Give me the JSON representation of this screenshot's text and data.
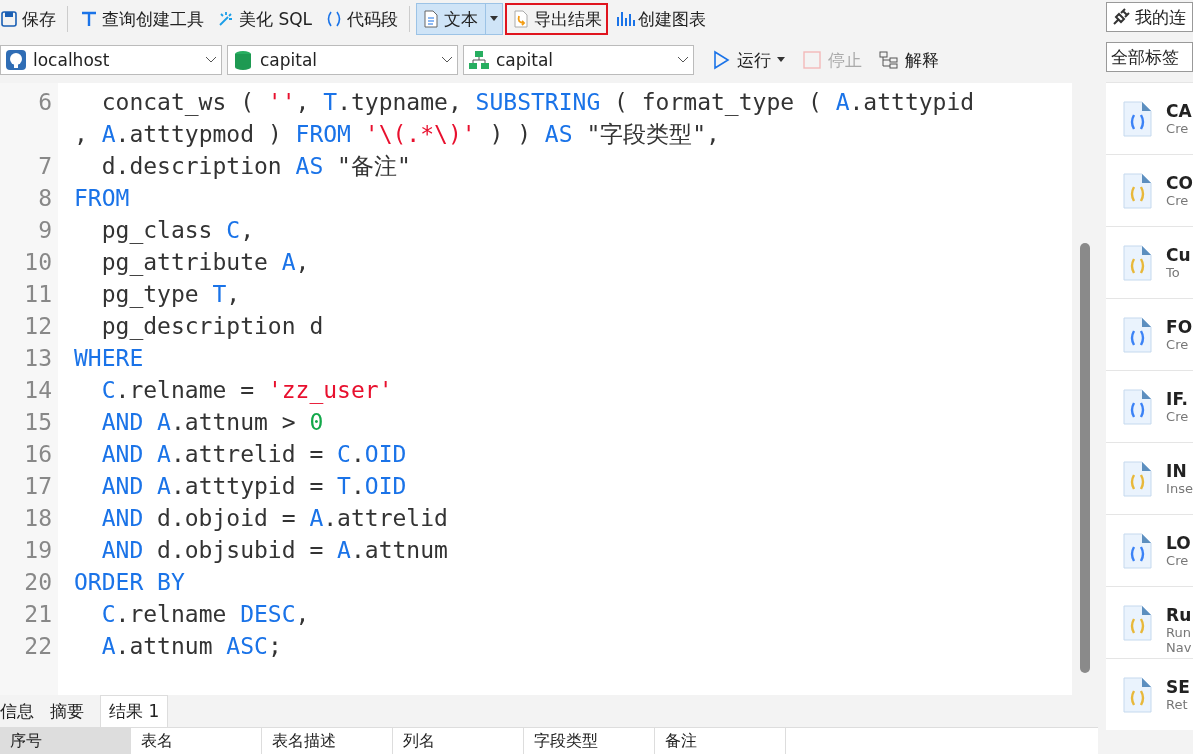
{
  "toolbar": {
    "buttons": [
      {
        "label": "保存",
        "kind": "save",
        "selected": false,
        "highlighted": false,
        "dropdown": false
      },
      {
        "label": "查询创建工具",
        "kind": "builder",
        "selected": false,
        "highlighted": false,
        "dropdown": false
      },
      {
        "label": "美化 SQL",
        "kind": "beautify",
        "selected": false,
        "highlighted": false,
        "dropdown": false
      },
      {
        "label": "代码段",
        "kind": "snippet",
        "selected": false,
        "highlighted": false,
        "dropdown": false
      },
      {
        "label": "文本",
        "kind": "text",
        "selected": true,
        "highlighted": false,
        "dropdown": true
      },
      {
        "label": "导出结果",
        "kind": "export",
        "selected": false,
        "highlighted": true,
        "dropdown": false
      },
      {
        "label": "创建图表",
        "kind": "chart",
        "selected": false,
        "highlighted": false,
        "dropdown": false
      }
    ]
  },
  "connection_bar": {
    "selects": [
      {
        "value": "localhost",
        "kind": "server"
      },
      {
        "value": "capital",
        "kind": "database"
      },
      {
        "value": "capital",
        "kind": "schema"
      }
    ],
    "actions": [
      {
        "label": "运行",
        "kind": "run",
        "disabled": false,
        "dropdown": true
      },
      {
        "label": "停止",
        "kind": "stop",
        "disabled": true,
        "dropdown": false
      },
      {
        "label": "解释",
        "kind": "explain",
        "disabled": false,
        "dropdown": false
      }
    ]
  },
  "editor": {
    "lines": [
      {
        "number": "6",
        "indent": true,
        "segments": [
          {
            "text": "concat_ws ( ",
            "kind": "plain"
          },
          {
            "text": "''",
            "kind": "string"
          },
          {
            "text": ", ",
            "kind": "plain"
          },
          {
            "text": "T",
            "kind": "alias"
          },
          {
            "text": ".typname, ",
            "kind": "plain"
          },
          {
            "text": "SUBSTRING",
            "kind": "keyword"
          },
          {
            "text": " ( format_type ( ",
            "kind": "plain"
          },
          {
            "text": "A",
            "kind": "alias"
          },
          {
            "text": ".atttypid",
            "kind": "plain"
          }
        ]
      },
      {
        "indent": false,
        "segments": [
          {
            "text": ", ",
            "kind": "plain"
          },
          {
            "text": "A",
            "kind": "alias"
          },
          {
            "text": ".atttypmod ) ",
            "kind": "plain"
          },
          {
            "text": "FROM ",
            "kind": "keyword"
          },
          {
            "text": "'\\(.*\\)'",
            "kind": "string"
          },
          {
            "text": " ) ) ",
            "kind": "plain"
          },
          {
            "text": "AS",
            "kind": "keyword"
          },
          {
            "text": " \"字段类型\",",
            "kind": "plain"
          }
        ]
      },
      {
        "number": "7",
        "indent": true,
        "segments": [
          {
            "text": "d.description ",
            "kind": "plain"
          },
          {
            "text": "AS",
            "kind": "keyword"
          },
          {
            "text": " \"备注\"",
            "kind": "plain"
          }
        ]
      },
      {
        "number": "8",
        "indent": false,
        "segments": [
          {
            "text": "FROM",
            "kind": "keyword"
          }
        ]
      },
      {
        "number": "9",
        "indent": true,
        "segments": [
          {
            "text": "pg_class ",
            "kind": "plain"
          },
          {
            "text": "C",
            "kind": "alias"
          },
          {
            "text": ",",
            "kind": "plain"
          }
        ]
      },
      {
        "number": "10",
        "indent": true,
        "segments": [
          {
            "text": "pg_attribute ",
            "kind": "plain"
          },
          {
            "text": "A",
            "kind": "alias"
          },
          {
            "text": ",",
            "kind": "plain"
          }
        ]
      },
      {
        "number": "11",
        "indent": true,
        "segments": [
          {
            "text": "pg_type ",
            "kind": "plain"
          },
          {
            "text": "T",
            "kind": "alias"
          },
          {
            "text": ",",
            "kind": "plain"
          }
        ]
      },
      {
        "number": "12",
        "indent": true,
        "segments": [
          {
            "text": "pg_description d",
            "kind": "plain"
          }
        ]
      },
      {
        "number": "13",
        "indent": false,
        "segments": [
          {
            "text": "WHERE",
            "kind": "keyword"
          }
        ]
      },
      {
        "number": "14",
        "indent": true,
        "segments": [
          {
            "text": "C",
            "kind": "alias"
          },
          {
            "text": ".relname = ",
            "kind": "plain"
          },
          {
            "text": "'zz_user'",
            "kind": "string"
          }
        ]
      },
      {
        "number": "15",
        "indent": true,
        "segments": [
          {
            "text": "AND A",
            "kind": "keyword"
          },
          {
            "text": ".attnum > ",
            "kind": "plain"
          },
          {
            "text": "0",
            "kind": "number"
          }
        ]
      },
      {
        "number": "16",
        "indent": true,
        "segments": [
          {
            "text": "AND A",
            "kind": "keyword"
          },
          {
            "text": ".attrelid = ",
            "kind": "plain"
          },
          {
            "text": "C",
            "kind": "alias"
          },
          {
            "text": ".",
            "kind": "plain"
          },
          {
            "text": "OID",
            "kind": "keyword"
          }
        ]
      },
      {
        "number": "17",
        "indent": true,
        "segments": [
          {
            "text": "AND A",
            "kind": "keyword"
          },
          {
            "text": ".atttypid = ",
            "kind": "plain"
          },
          {
            "text": "T",
            "kind": "alias"
          },
          {
            "text": ".",
            "kind": "plain"
          },
          {
            "text": "OID",
            "kind": "keyword"
          }
        ]
      },
      {
        "number": "18",
        "indent": true,
        "segments": [
          {
            "text": "AND",
            "kind": "keyword"
          },
          {
            "text": " d.objoid = ",
            "kind": "plain"
          },
          {
            "text": "A",
            "kind": "alias"
          },
          {
            "text": ".attrelid",
            "kind": "plain"
          }
        ]
      },
      {
        "number": "19",
        "indent": true,
        "segments": [
          {
            "text": "AND",
            "kind": "keyword"
          },
          {
            "text": " d.objsubid = ",
            "kind": "plain"
          },
          {
            "text": "A",
            "kind": "alias"
          },
          {
            "text": ".attnum",
            "kind": "plain"
          }
        ]
      },
      {
        "number": "20",
        "indent": false,
        "segments": [
          {
            "text": "ORDER BY",
            "kind": "keyword"
          }
        ]
      },
      {
        "number": "21",
        "indent": true,
        "segments": [
          {
            "text": "C",
            "kind": "alias"
          },
          {
            "text": ".relname ",
            "kind": "plain"
          },
          {
            "text": "DESC",
            "kind": "keyword"
          },
          {
            "text": ",",
            "kind": "plain"
          }
        ]
      },
      {
        "number": "22",
        "indent": true,
        "segments": [
          {
            "text": "A",
            "kind": "alias"
          },
          {
            "text": ".attnum ",
            "kind": "plain"
          },
          {
            "text": "ASC",
            "kind": "keyword"
          },
          {
            "text": ";",
            "kind": "plain"
          }
        ]
      }
    ]
  },
  "result_tabs": [
    {
      "label": "信息",
      "selected": false
    },
    {
      "label": "摘要",
      "selected": false
    },
    {
      "label": "结果 1",
      "selected": true
    }
  ],
  "result_columns": [
    "序号",
    "表名",
    "表名描述",
    "列名",
    "字段类型",
    "备注"
  ],
  "side_panel": {
    "connection_button": "我的连",
    "tag_filter": "全部标签",
    "snippets": [
      {
        "title": "CA",
        "description": [
          "Cre"
        ],
        "color": "#3b82f6"
      },
      {
        "title": "CO",
        "description": [
          "Cre"
        ],
        "color": "#e8b83a"
      },
      {
        "title": "Cu",
        "description": [
          "To"
        ],
        "color": "#e8b83a"
      },
      {
        "title": "FO",
        "description": [
          "Cre"
        ],
        "color": "#3b82f6"
      },
      {
        "title": "IF.",
        "description": [
          "Cre"
        ],
        "color": "#3b82f6"
      },
      {
        "title": "IN",
        "description": [
          "Inse"
        ],
        "color": "#e8b83a"
      },
      {
        "title": "LO",
        "description": [
          "Cre"
        ],
        "color": "#3b82f6"
      },
      {
        "title": "Ru",
        "description": [
          "Run",
          "Nav"
        ],
        "color": "#e8b83a"
      },
      {
        "title": "SE",
        "description": [
          "Ret"
        ],
        "color": "#e8b83a"
      }
    ]
  }
}
